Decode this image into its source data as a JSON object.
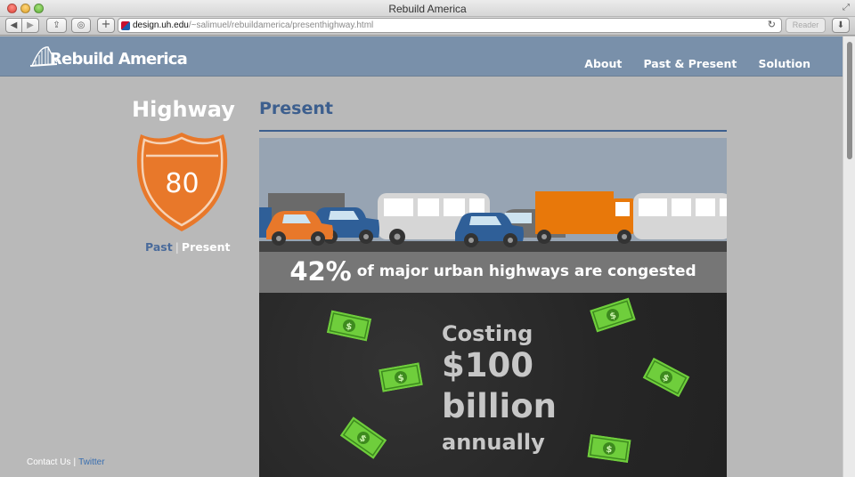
{
  "browser": {
    "window_title": "Rebuild America",
    "url_host": "design.uh.edu",
    "url_path": "/~salimuel/rebuildamerica/presenthighway.html",
    "reader_label": "Reader"
  },
  "site": {
    "logo_text": "Rebuild America",
    "nav": [
      "About",
      "Past & Present",
      "Solution"
    ],
    "header_color": "#7990aa"
  },
  "sidebar": {
    "title": "Highway",
    "shield_number": "80",
    "shield_color": "#e8782a",
    "link_past": "Past",
    "link_separator": "|",
    "link_present": "Present"
  },
  "footer": {
    "contact": "Contact Us",
    "separator": "|",
    "twitter": "Twitter"
  },
  "main": {
    "section_title": "Present",
    "stat_percent": "42%",
    "stat_text": "of major urban highways are congested",
    "cost_line1": "Costing",
    "cost_line2": "$100",
    "cost_line3": "billion",
    "cost_line4": "annually"
  }
}
